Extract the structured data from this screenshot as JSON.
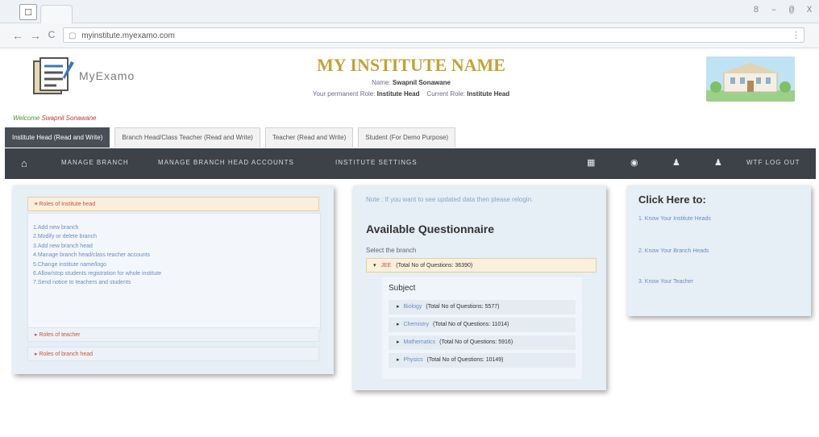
{
  "browser": {
    "url": "myinstitute.myexamo.com",
    "window_controls": [
      "8",
      "–",
      "@",
      "X"
    ],
    "nav": {
      "back": "←",
      "forward": "→",
      "reload": "C"
    }
  },
  "header": {
    "logo_text": "MyExamo",
    "institute_title": "MY INSTITUTE NAME",
    "name_label": "Name:",
    "name_value": "Swapnil Sonawane",
    "permanent_role_label": "Your permanent Role:",
    "permanent_role_value": "Institute Head",
    "current_role_label": "Current Role:",
    "current_role_value": "Institute Head",
    "welcome_label": "Welcome",
    "welcome_name": "Swapnil Sonawane"
  },
  "role_tabs": [
    {
      "label": "Institute Head (Read and Write)"
    },
    {
      "label": "Branch Head/Class Teacher (Read and Write)"
    },
    {
      "label": "Teacher (Read and Write)"
    },
    {
      "label": "Student (For Demo Purpose)"
    }
  ],
  "menu": {
    "items": [
      "MANAGE BRANCH",
      "MANAGE BRANCH HEAD ACCOUNTS",
      "INSTITUTE SETTINGS"
    ],
    "right_text": "WTF  LOG OUT"
  },
  "roles_panel": {
    "open_header": "▾  Roles of Institute head",
    "items": [
      "1.Add new branch",
      "2.Modify or delete branch",
      "3.Add new branch head",
      "4.Manage branch head/class teacher accounts",
      "5.Change institute name/logo",
      "6.Allow/stop students registration for whole institute",
      "7.Send notice to teachers and students"
    ],
    "collapsed": [
      "▸  Roles of teacher",
      "▸  Roles of branch head"
    ]
  },
  "questionnaire": {
    "note": "Note : If you want to see updated data then please relogin.",
    "title": "Available Questionnaire",
    "select_label": "Select the branch",
    "branch": {
      "name": "JEE",
      "total": "(Total No of Questions: 36390)"
    },
    "subject_label": "Subject",
    "subjects": [
      {
        "name": "Biology",
        "total": "(Total No of Questions: 5577)"
      },
      {
        "name": "Chemistry",
        "total": "(Total No of Questions: 11014)"
      },
      {
        "name": "Mathematics",
        "total": "(Total No of Questions: 5916)"
      },
      {
        "name": "Physics",
        "total": "(Total No of Questions: 10149)"
      }
    ]
  },
  "click_here": {
    "title": "Click Here to:",
    "links": [
      "1. Know Your Institute Heads",
      "2. Know Your Branch Heads",
      "3. Know Your Teacher"
    ]
  }
}
